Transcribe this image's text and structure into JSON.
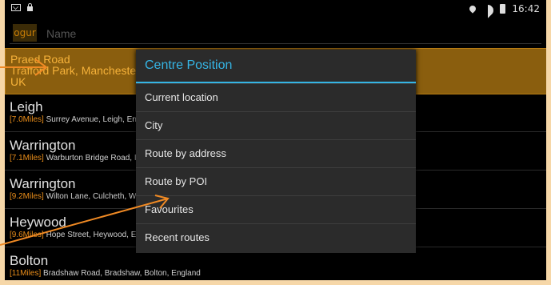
{
  "status_bar": {
    "time": "16:42"
  },
  "search": {
    "logo_text": "ogur",
    "placeholder": "Name"
  },
  "list": [
    {
      "title": "Praed Road",
      "line2": "Trafford Park, Manchester",
      "line3": "UK",
      "selected": true
    },
    {
      "title": "Leigh",
      "distance": "[7.0Miles]",
      "address": " Surrey Avenue, Leigh, Eng"
    },
    {
      "title": "Warrington",
      "distance": "[7.1Miles]",
      "address": " Warburton Bridge Road, I"
    },
    {
      "title": "Warrington",
      "distance": "[9.2Miles]",
      "address": " Wilton Lane, Culcheth, W"
    },
    {
      "title": "Heywood",
      "distance": "[9.6Miles]",
      "address": " Hope Street, Heywood, En"
    },
    {
      "title": "Bolton",
      "distance": "[11Miles]",
      "address": " Bradshaw Road, Bradshaw, Bolton, England"
    }
  ],
  "dialog": {
    "title": "Centre Position",
    "options": [
      "Current location",
      "City",
      "Route by address",
      "Route by POI",
      "Favourites",
      "Recent routes"
    ]
  },
  "colors": {
    "accent": "#35b5e5",
    "selection": "#8a5e0e",
    "annotation_arrow": "#f08a24"
  }
}
